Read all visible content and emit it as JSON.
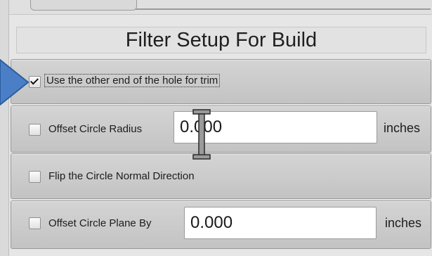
{
  "panel": {
    "title": "Filter Setup For Build"
  },
  "rows": [
    {
      "label": "Use the other end of the hole for trim",
      "checked": true
    },
    {
      "label": "Offset Circle Radius",
      "checked": false,
      "value": "0.000",
      "unit": "inches"
    },
    {
      "label": "Flip the Circle Normal Direction",
      "checked": false
    },
    {
      "label": "Offset Circle Plane By",
      "checked": false,
      "value": "0.000",
      "unit": "inches"
    }
  ],
  "icons": {
    "pointer": "arrow-pointer-icon",
    "cursor": "text-cursor-icon",
    "highlight_color": "#4a7fc8"
  }
}
